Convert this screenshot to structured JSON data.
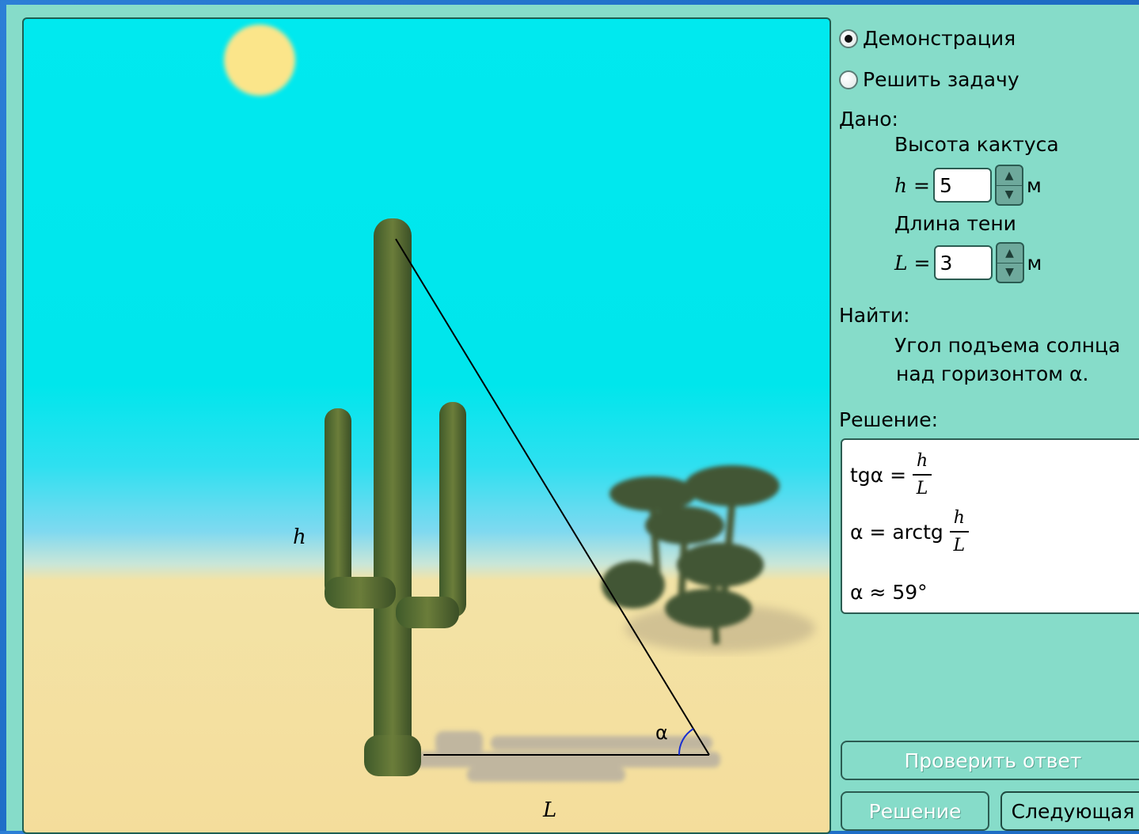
{
  "modes": {
    "demo_label": "Демонстрация",
    "solve_label": "Решить задачу",
    "selected": "demo"
  },
  "given": {
    "title": "Дано:",
    "height_label": "Высота кактуса",
    "height_var": "h =",
    "height_value": "5",
    "height_unit": "м",
    "shadow_label": "Длина тени",
    "shadow_var": "L =",
    "shadow_value": "3",
    "shadow_unit": "м"
  },
  "find": {
    "title": "Найти:",
    "line1": "Угол подъема солнца",
    "line2": "над горизонтом α."
  },
  "solution": {
    "title": "Решение:",
    "eq1_lhs": "tgα =",
    "eq2_lhs": "α = arctg",
    "frac_num": "h",
    "frac_den": "L",
    "result": "α ≈ 59°"
  },
  "buttons": {
    "check": "Проверить ответ",
    "solution": "Решение",
    "next": "Следующая"
  },
  "scene": {
    "h_label": "h",
    "l_label": "L",
    "alpha_label": "α"
  }
}
